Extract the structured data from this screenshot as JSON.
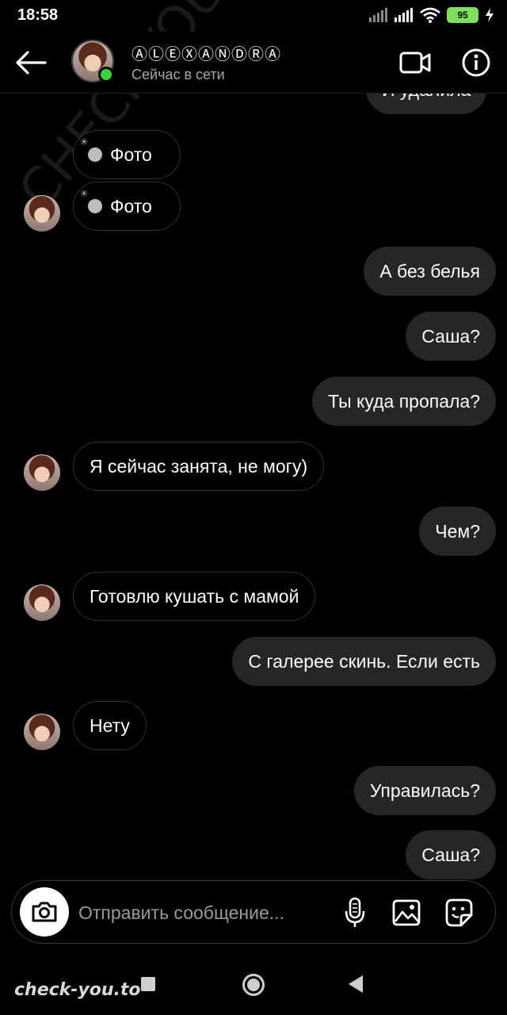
{
  "status_bar": {
    "time": "18:58",
    "battery": "95"
  },
  "header": {
    "contact_name": "ⒶⓁⒺⓍⒶⓃⒹⓇⒶ",
    "contact_status": "Сейчас в сети",
    "icons": [
      "back-arrow-icon",
      "video-call-icon",
      "info-icon"
    ]
  },
  "messages": [
    {
      "direction": "out",
      "text": "И удалила"
    },
    {
      "direction": "in",
      "text": "Фото",
      "type": "photo"
    },
    {
      "direction": "in",
      "text": "Фото",
      "type": "photo"
    },
    {
      "direction": "out",
      "text": "А без белья"
    },
    {
      "direction": "out",
      "text": "Саша?"
    },
    {
      "direction": "out",
      "text": "Ты куда пропала?"
    },
    {
      "direction": "in",
      "text": "Я сейчас занята, не могу)"
    },
    {
      "direction": "out",
      "text": "Чем?"
    },
    {
      "direction": "in",
      "text": "Готовлю кушать с мамой"
    },
    {
      "direction": "out",
      "text": "С галерее скинь. Если есть"
    },
    {
      "direction": "in",
      "text": "Нету"
    },
    {
      "direction": "out",
      "text": "Управилась?"
    },
    {
      "direction": "out",
      "text": "Саша?"
    }
  ],
  "composer": {
    "placeholder": "Отправить сообщение...",
    "icons": [
      "camera-icon",
      "microphone-icon",
      "gallery-icon",
      "sticker-icon"
    ]
  },
  "watermark": {
    "bottom": "check-you.to",
    "diagonal": "CHECK-YOU.ME"
  },
  "colors": {
    "background": "#000000",
    "outgoing_bubble": "#262626",
    "online": "#3ad13a",
    "battery": "#7fe05a"
  }
}
